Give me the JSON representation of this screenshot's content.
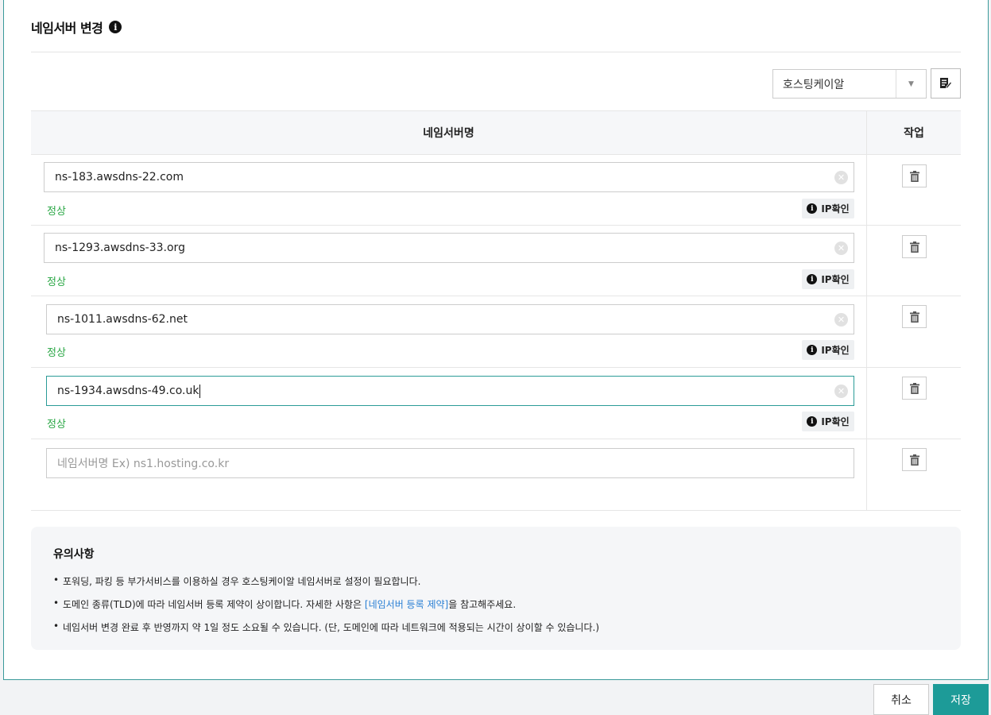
{
  "title": "네임서버 변경",
  "title_info_icon": "info-icon",
  "hosting_select": {
    "value": "호스팅케이알",
    "arrow": "▼"
  },
  "table": {
    "col_name": "네임서버명",
    "col_action": "작업"
  },
  "rows": [
    {
      "value": "ns-183.awsdns-22.com",
      "status": "정상",
      "ip_button": "IP확인"
    },
    {
      "value": "ns-1293.awsdns-33.org",
      "status": "정상",
      "ip_button": "IP확인"
    },
    {
      "value": "ns-1011.awsdns-62.net",
      "status": "정상",
      "ip_button": "IP확인"
    },
    {
      "value": "ns-1934.awsdns-49.co.uk",
      "status": "정상",
      "ip_button": "IP확인"
    }
  ],
  "new_row": {
    "placeholder": "네임서버명 Ex) ns1.hosting.co.kr"
  },
  "notice": {
    "title": "유의사항",
    "item1": "포워딩, 파킹 등 부가서비스를 이용하실 경우 호스팅케이알 네임서버로 설정이 필요합니다.",
    "item2_pre": "도메인 종류(TLD)에 따라 네임서버 등록 제약이 상이합니다. 자세한 사항은 ",
    "item2_link": "[네임서버 등록 제약]",
    "item2_post": "을 참고해주세요.",
    "item3": "네임서버 변경 완료 후 반영까지 약 1일 정도 소요될 수 있습니다. (단, 도메인에 따라 네트워크에 적용되는 시간이 상이할 수 있습니다.)"
  },
  "buttons": {
    "cancel": "취소",
    "save": "저장"
  },
  "colors": {
    "accent": "#1d9b98",
    "status_ok": "#2aa745",
    "link": "#2a7fd4"
  }
}
